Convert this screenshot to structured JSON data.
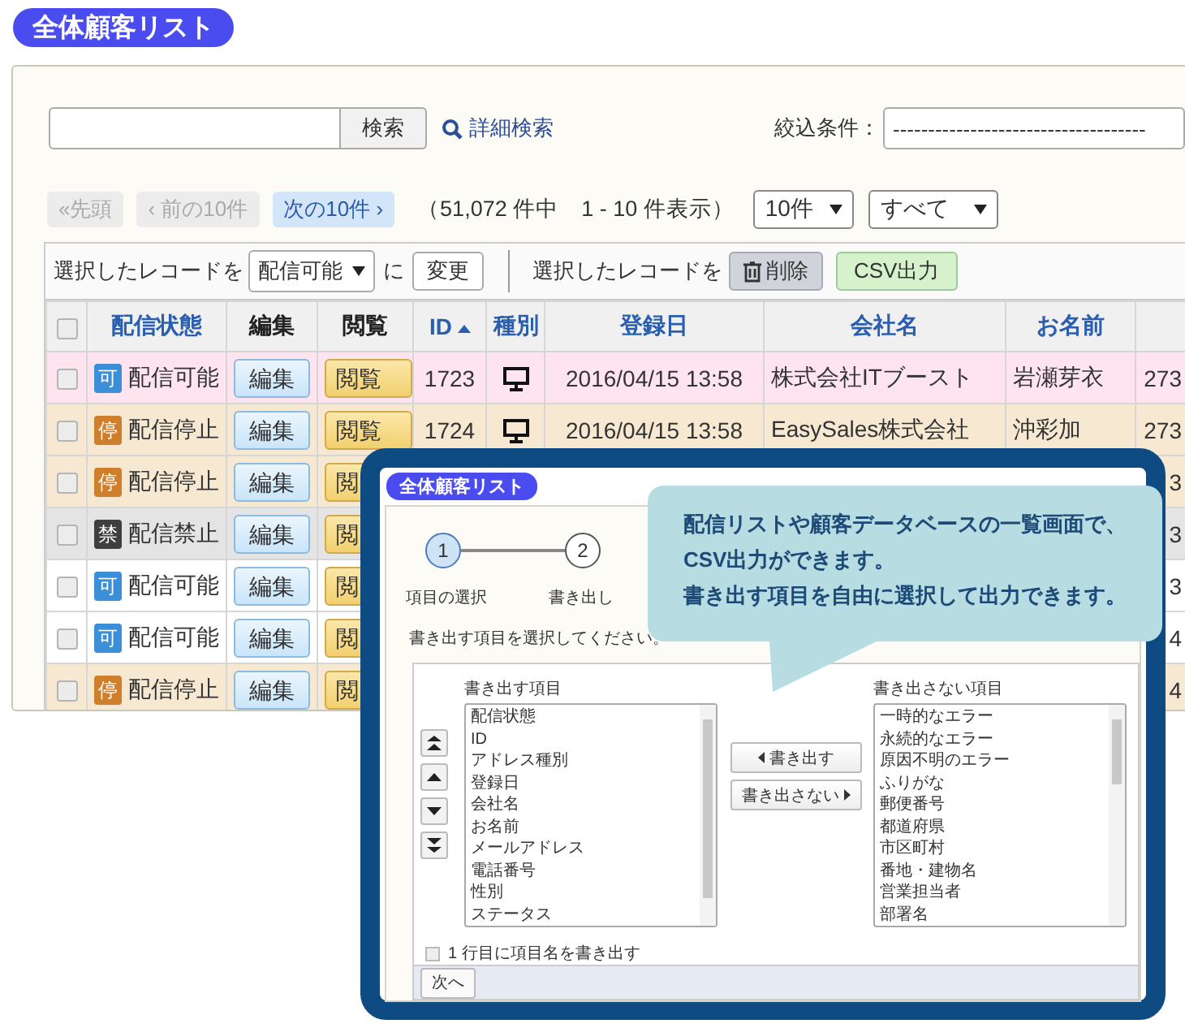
{
  "page_title": "全体顧客リスト",
  "search": {
    "button": "検索",
    "advanced_link": "詳細検索",
    "filter_label": "絞込条件：",
    "filter_value": "------------------------------------"
  },
  "pagination": {
    "buttons": [
      {
        "label": "«先頭",
        "disabled": true
      },
      {
        "label": "‹ 前の10件",
        "disabled": true
      },
      {
        "label": "次の10件 ›",
        "disabled": false
      }
    ],
    "summary": "（51,072 件中　1 - 10 件表示）",
    "per_page": "10件",
    "scope": "すべて"
  },
  "bulk_actions": {
    "label": "選択したレコードを",
    "status_value": "配信可能",
    "particle": "に",
    "change_button": "変更",
    "label_2": "選択したレコードを",
    "delete_button": "削除",
    "csv_button": "CSV出力"
  },
  "table": {
    "select_all_checked": false,
    "columns": [
      {
        "label": "配信状態",
        "sortable": true,
        "sorted": false
      },
      {
        "label": "編集",
        "sortable": false,
        "sorted": false
      },
      {
        "label": "閲覧",
        "sortable": false,
        "sorted": false
      },
      {
        "label": "ID",
        "sortable": true,
        "sorted": true
      },
      {
        "label": "種別",
        "sortable": true,
        "sorted": false
      },
      {
        "label": "登録日",
        "sortable": true,
        "sorted": false
      },
      {
        "label": "会社名",
        "sortable": true,
        "sorted": false
      },
      {
        "label": "お名前",
        "sortable": true,
        "sorted": false
      }
    ],
    "rows": [
      {
        "checked": false,
        "highlighted": true,
        "kind": "ok",
        "status_badge": "可",
        "status": "配信可能",
        "edit": "編集",
        "view": "閲覧",
        "id": "1723",
        "type": {
          "kind": "pc"
        },
        "registered": "2016/04/15 13:58",
        "company": "株式会社ITブースト",
        "name": "岩瀬芽衣",
        "column_9": "273"
      },
      {
        "checked": false,
        "highlighted": false,
        "kind": "stop",
        "status_badge": "停",
        "status": "配信停止",
        "edit": "編集",
        "view": "閲覧",
        "id": "1724",
        "type": {
          "kind": "pc"
        },
        "registered": "2016/04/15 13:58",
        "company": "EasySales株式会社",
        "name": "沖彩加",
        "column_9": "273"
      },
      {
        "checked": false,
        "highlighted": false,
        "kind": "stop",
        "status_badge": "停",
        "status": "配信停止",
        "edit": "編集",
        "view": "閲",
        "column_9": "3"
      },
      {
        "checked": false,
        "highlighted": false,
        "kind": "ban",
        "status_badge": "禁",
        "status": "配信禁止",
        "edit": "編集",
        "view": "閲",
        "column_9": "3"
      },
      {
        "checked": false,
        "highlighted": false,
        "kind": "ok",
        "status_badge": "可",
        "status": "配信可能",
        "edit": "編集",
        "view": "閲",
        "column_9": "3"
      },
      {
        "checked": false,
        "highlighted": false,
        "kind": "ok",
        "status_badge": "可",
        "status": "配信可能",
        "edit": "編集",
        "view": "閲",
        "column_9": "4"
      },
      {
        "checked": false,
        "highlighted": false,
        "kind": "stop",
        "status_badge": "停",
        "status": "配信停止",
        "edit": "編集",
        "view": "閲",
        "column_9": "4"
      }
    ]
  },
  "export_dialog": {
    "title": "全体顧客リスト",
    "steps": [
      {
        "number": "1",
        "label": "項目の選択",
        "selected": true
      },
      {
        "number": "2",
        "label": "書き出し",
        "selected": false
      }
    ],
    "callout": [
      "配信リストや顧客データベースの一覧画面で、",
      "CSV出力ができます。",
      "書き出す項目を自由に選択して出力できます。"
    ],
    "instruction": "書き出す項目を選択してください。",
    "export_list": {
      "label": "書き出す項目",
      "items": [
        "配信状態",
        "ID",
        "アドレス種別",
        "登録日",
        "会社名",
        "お名前",
        "メールアドレス",
        "電話番号",
        "性別",
        "ステータス"
      ]
    },
    "add_button": "書き出す",
    "remove_button": "書き出さない",
    "excluded_list": {
      "label": "書き出さない項目",
      "items": [
        "一時的なエラー",
        "永続的なエラー",
        "原因不明のエラー",
        "ふりがな",
        "郵便番号",
        "都道府県",
        "市区町村",
        "番地・建物名",
        "営業担当者",
        "部署名"
      ]
    },
    "header_row": {
      "label": "1 行目に項目名を書き出す",
      "checked": false
    },
    "next_button": "次へ"
  }
}
